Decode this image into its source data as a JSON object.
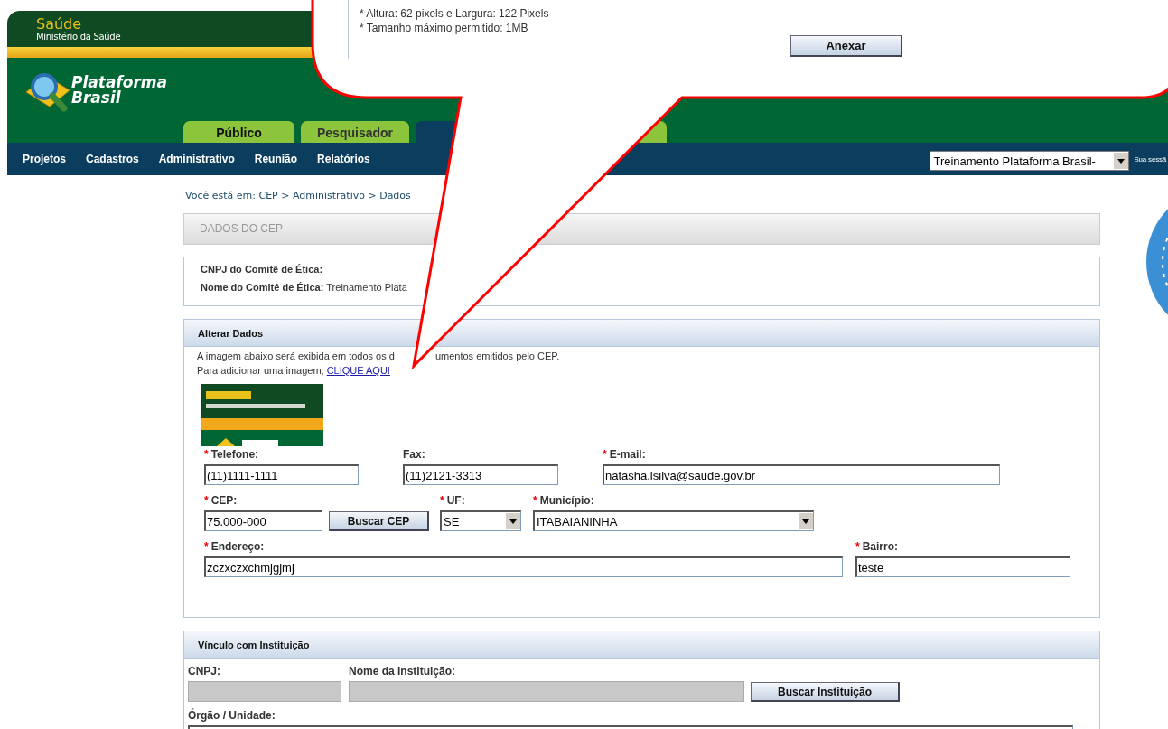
{
  "header": {
    "ministry_title": "Saúde",
    "ministry_subtitle": "Ministério da Saúde",
    "logo_lines": [
      "Plataforma",
      "Brasil"
    ]
  },
  "tabs": [
    {
      "label": "Público",
      "selected": false
    },
    {
      "label": "Pesquisador",
      "selected": false
    },
    {
      "selected": true
    },
    {
      "selected": false
    }
  ],
  "menu": [
    "Projetos",
    "Cadastros",
    "Administrativo",
    "Reunião",
    "Relatórios"
  ],
  "context_select": {
    "value": "Treinamento Plataforma Brasil-"
  },
  "session_text": "Sua sessã",
  "breadcrumb": "Você está em: CEP > Administrativo > Dados",
  "page_title": "DADOS DO CEP",
  "committee": [
    {
      "label": "CNPJ do Comitê de Ética:"
    },
    {
      "label": "Nome do Comitê de Ética:",
      "value": "Treinamento Plata"
    }
  ],
  "alterar": {
    "title": "Alterar Dados",
    "intro": [
      "A imagem abaixo será exibida em todos os d",
      "umentos emitidos pelo CEP."
    ],
    "add_text": "Para adicionar uma imagem,",
    "add_link": "CLIQUE AQUI",
    "rows": [
      [
        {
          "kind": "text",
          "mark": "*",
          "label": "Telefone:",
          "value": "(11)1111-1111"
        },
        {
          "kind": "text",
          "label": "Fax:",
          "value": "(11)2121-3313"
        },
        {
          "kind": "text",
          "mark": "*",
          "label": "E-mail:",
          "value": "natasha.lsilva@saude.gov.br"
        }
      ],
      [
        {
          "kind": "text",
          "mark": "*",
          "label": "CEP:",
          "value": "75.000-000"
        },
        {
          "kind": "button",
          "label": "Buscar CEP"
        },
        {
          "kind": "select",
          "mark": "*",
          "label": "UF:",
          "value": "SE"
        },
        {
          "kind": "select",
          "mark": "*",
          "label": "Município:",
          "value": "ITABAIANINHA"
        }
      ],
      [
        {
          "kind": "text",
          "mark": "*",
          "label": "Endereço:",
          "value": "zczxczxchmjgjmj"
        },
        {
          "kind": "text",
          "mark": "*",
          "label": "Bairro:",
          "value": "teste"
        }
      ]
    ]
  },
  "vinculo": {
    "title": "Vínculo com Instituição",
    "rows": [
      [
        {
          "kind": "text",
          "label": "CNPJ:",
          "disabled": true
        },
        {
          "kind": "text",
          "label": "Nome da Instituição:",
          "disabled": true
        },
        {
          "kind": "button",
          "label": "Buscar Instituição"
        }
      ],
      [
        {
          "kind": "text",
          "label": "Órgão / Unidade:",
          "disabled": false
        }
      ]
    ]
  },
  "callout": {
    "notes": [
      "* Altura: 62 pixels e Largura: 122 Pixels",
      "* Tamanho máximo permitido: 1MB"
    ],
    "button": "Anexar"
  }
}
